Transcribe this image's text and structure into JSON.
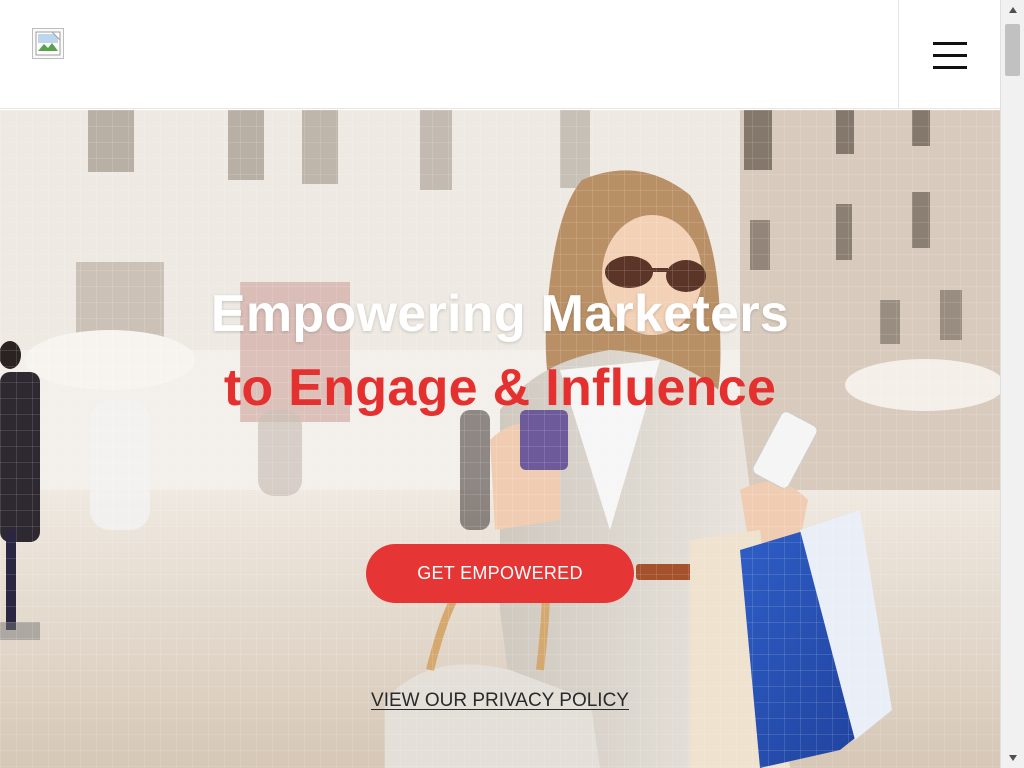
{
  "header": {
    "logo_icon": "broken-image-icon",
    "menu_icon": "hamburger-menu-icon"
  },
  "hero": {
    "title_line1": "Empowering Marketers",
    "title_line2": "to Engage & Influence",
    "cta_label": "GET EMPOWERED",
    "privacy_link": "VIEW OUR PRIVACY POLICY"
  },
  "colors": {
    "accent_red": "#e53535",
    "title_white": "#ffffff",
    "link_dark": "#2a2a2a"
  }
}
